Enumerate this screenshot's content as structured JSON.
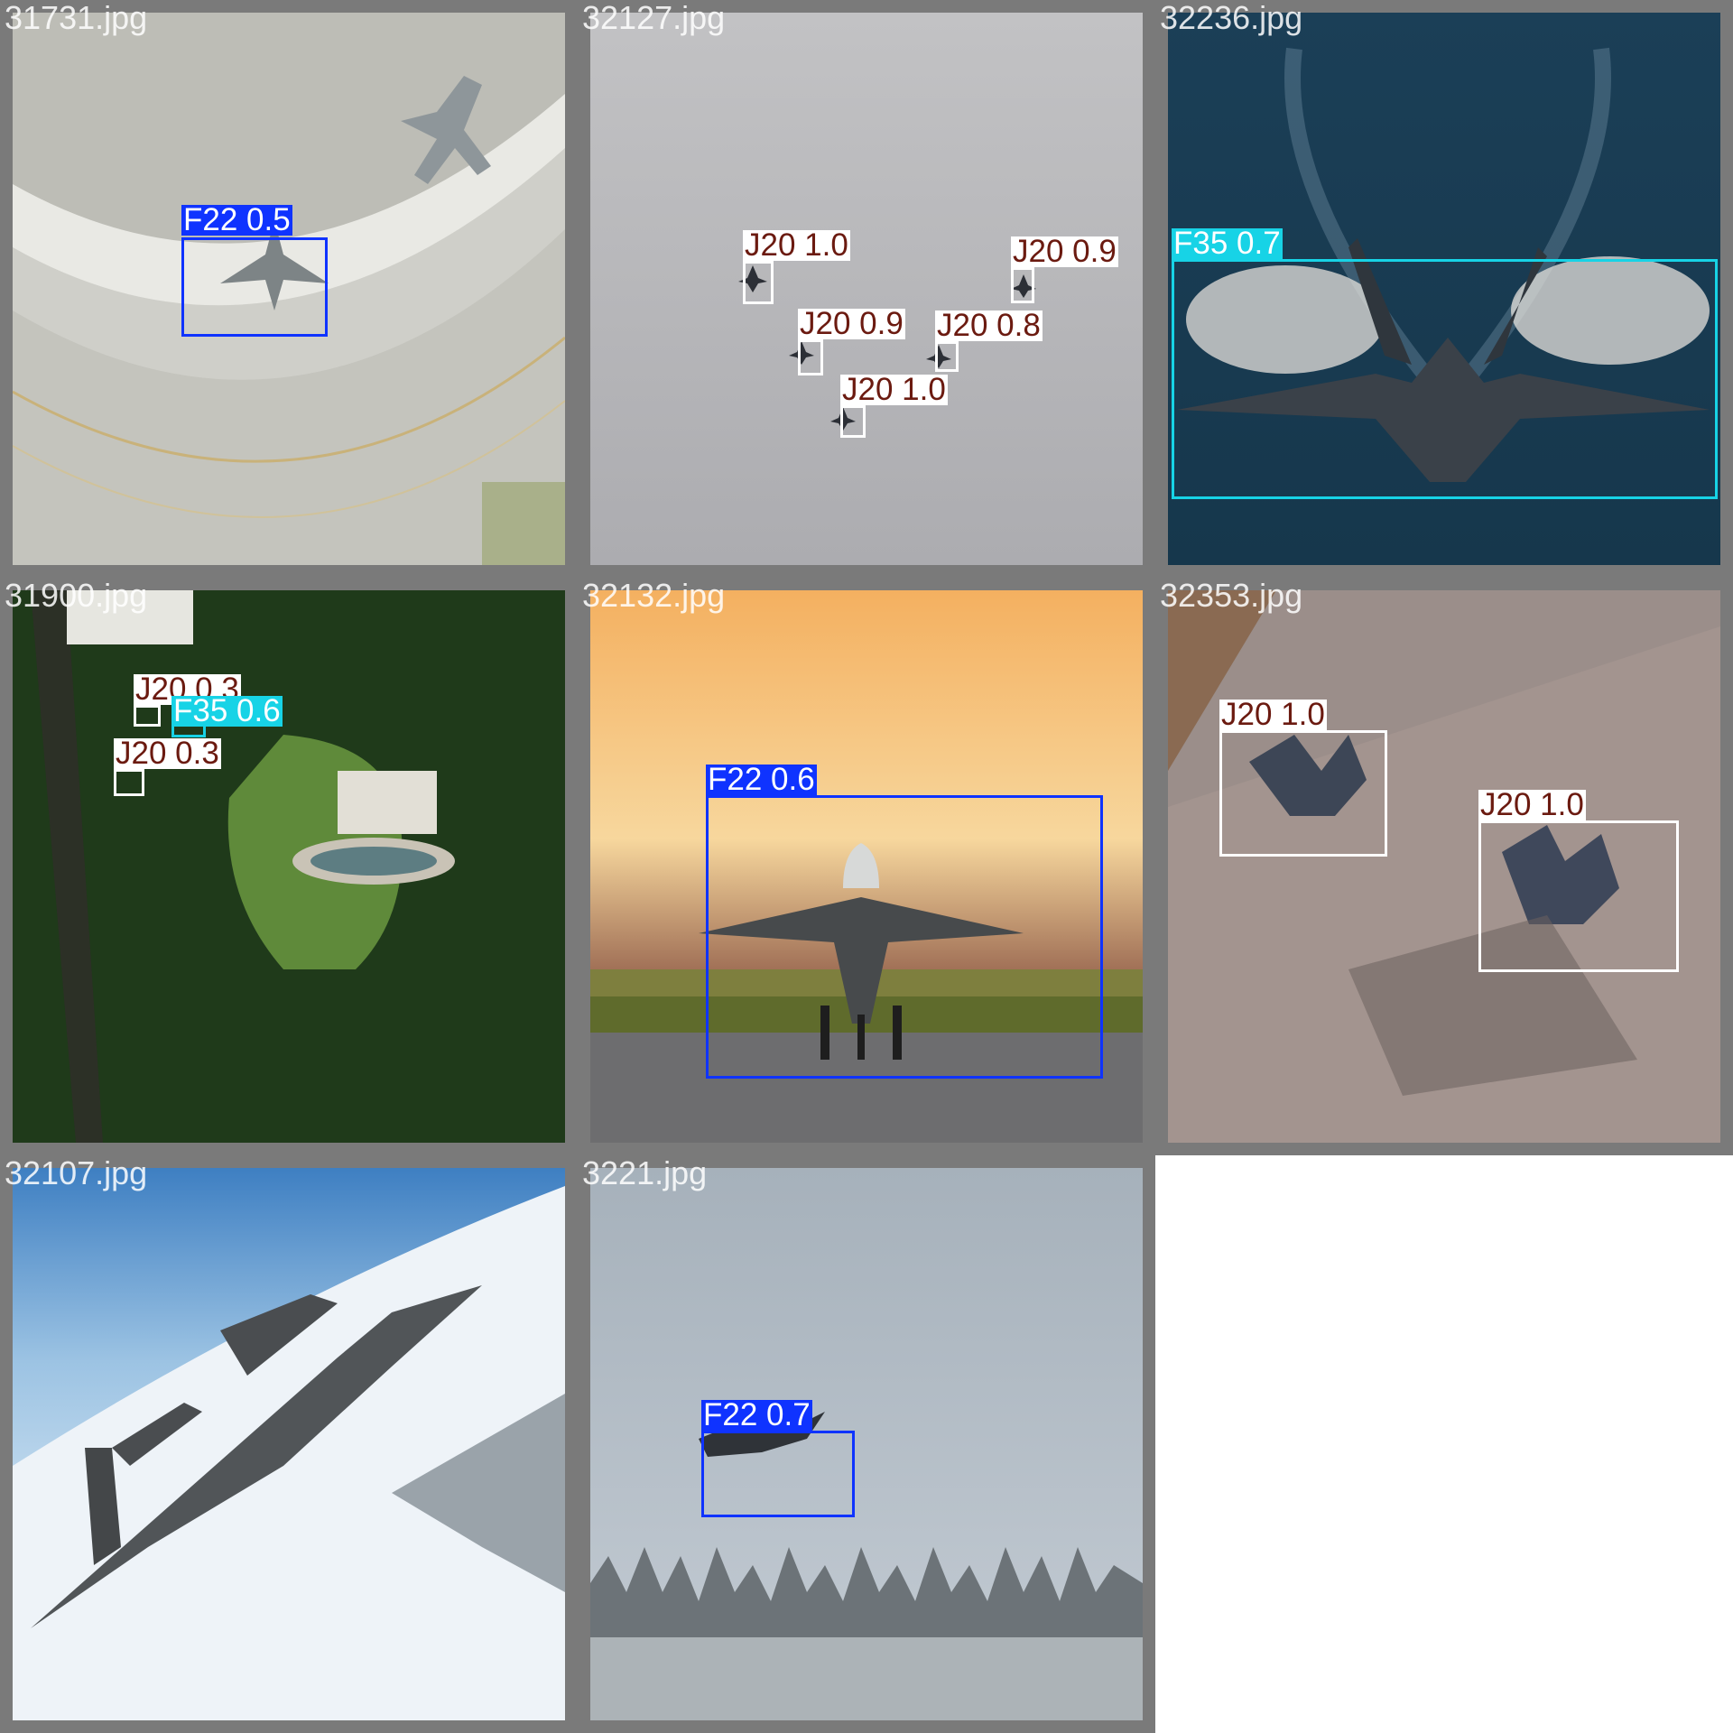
{
  "colors": {
    "F22": "#0f33ff",
    "J20": "#ffffff",
    "F35": "#17d3e6",
    "F22_text": "#ffffff",
    "J20_text": "#6b1a10",
    "F35_text": "#ffffff"
  },
  "tiles": [
    {
      "file_name": "31731.jpg",
      "scene": "airfield-apron",
      "detections": [
        {
          "class": "F22",
          "label": "F22 0.5",
          "confidence": 0.5
        }
      ]
    },
    {
      "file_name": "32127.jpg",
      "scene": "overcast-sky",
      "detections": [
        {
          "class": "J20",
          "label": "J20 1.0",
          "confidence": 1.0
        },
        {
          "class": "J20",
          "label": "J20 0.9",
          "confidence": 0.9
        },
        {
          "class": "J20",
          "label": "J20 0.9",
          "confidence": 0.9
        },
        {
          "class": "J20",
          "label": "J20 0.8",
          "confidence": 0.8
        },
        {
          "class": "J20",
          "label": "J20 1.0",
          "confidence": 1.0
        }
      ]
    },
    {
      "file_name": "32236.jpg",
      "scene": "night-sky",
      "detections": [
        {
          "class": "F35",
          "label": "F35 0.7",
          "confidence": 0.7
        }
      ]
    },
    {
      "file_name": "31900.jpg",
      "scene": "forest-aerial",
      "detections": [
        {
          "class": "J20",
          "label": "J20 0.3",
          "confidence": 0.3
        },
        {
          "class": "F35",
          "label": "F35 0.6",
          "confidence": 0.6
        },
        {
          "class": "J20",
          "label": "J20 0.3",
          "confidence": 0.3
        }
      ]
    },
    {
      "file_name": "32132.jpg",
      "scene": "sunset-runway",
      "detections": [
        {
          "class": "F22",
          "label": "F22 0.6",
          "confidence": 0.6
        }
      ]
    },
    {
      "file_name": "32353.jpg",
      "scene": "concrete-runway",
      "detections": [
        {
          "class": "J20",
          "label": "J20 1.0",
          "confidence": 1.0
        },
        {
          "class": "J20",
          "label": "J20 1.0",
          "confidence": 1.0
        }
      ]
    },
    {
      "file_name": "32107.jpg",
      "scene": "above-clouds",
      "detections": []
    },
    {
      "file_name": "3221.jpg",
      "scene": "snowy-forest",
      "detections": [
        {
          "class": "F22",
          "label": "F22 0.7",
          "confidence": 0.7
        }
      ]
    }
  ]
}
